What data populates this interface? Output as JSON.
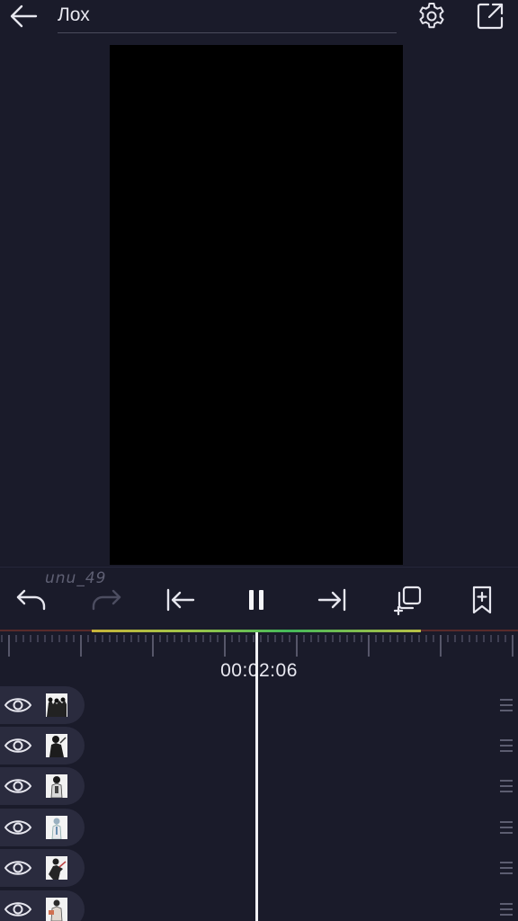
{
  "header": {
    "title": "Лох",
    "back_icon": "arrow-left-icon",
    "settings_icon": "gear-icon",
    "export_icon": "external-link-icon"
  },
  "controls": {
    "watermark": "unu_49",
    "buttons": [
      "undo-icon",
      "redo-icon",
      "skip-to-start-icon",
      "pause-icon",
      "skip-to-end-icon",
      "add-layer-icon",
      "add-bookmark-icon"
    ]
  },
  "timeline": {
    "current_time": "00:02:06",
    "playhead_color": "#f0f0f4"
  },
  "layers": [
    {
      "name": "layer-1",
      "visible": true,
      "drag": "drag-handle-icon"
    },
    {
      "name": "layer-2",
      "visible": true,
      "drag": "drag-handle-icon"
    },
    {
      "name": "layer-3",
      "visible": true,
      "drag": "drag-handle-icon"
    },
    {
      "name": "layer-4",
      "visible": true,
      "drag": "drag-handle-icon"
    },
    {
      "name": "layer-5",
      "visible": true,
      "drag": "drag-handle-icon"
    },
    {
      "name": "layer-6",
      "visible": true,
      "drag": "drag-handle-icon"
    }
  ],
  "colors": {
    "background": "#1a1b2a",
    "canvas": "#000000",
    "layer_pill": "#2a2b3e",
    "icon": "#e6e6ee"
  }
}
